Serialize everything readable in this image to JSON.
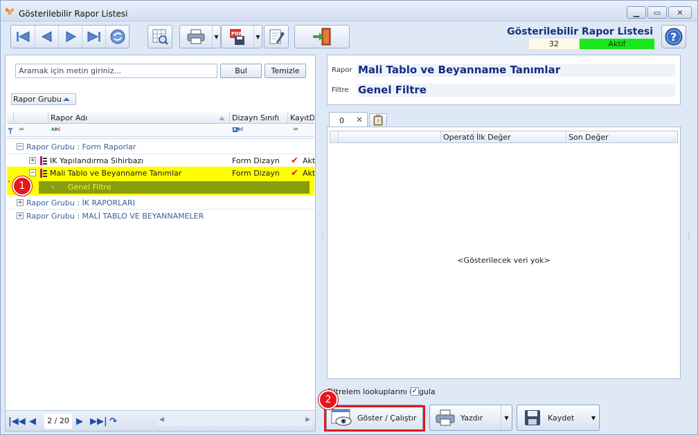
{
  "window": {
    "title": "Gösterilebilir Rapor Listesi"
  },
  "header": {
    "title": "Gösterilebilir Rapor Listesi",
    "count": "32",
    "status": "Aktif",
    "status_color": "#19e81c"
  },
  "toolbar": {
    "icons": [
      "first-icon",
      "prev-icon",
      "next-icon",
      "last-icon",
      "refresh-icon",
      "grid-search-icon",
      "print-icon",
      "pdf-export-icon",
      "settings-icon",
      "exit-icon"
    ]
  },
  "search": {
    "placeholder": "Aramak için metin giriniz...",
    "find_label": "Bul",
    "clear_label": "Temizle"
  },
  "group_panel": {
    "chip_label": "Rapor Grubu"
  },
  "grid": {
    "columns": [
      "Rapor Adı",
      "Dizayn Sınıfı",
      "KayıtDı"
    ],
    "groups": [
      {
        "label": "Rapor Grubu : Form Raporlar",
        "rows": [
          {
            "name": "IK Yapılandırma Sihirbazı",
            "design": "Form Dizayn",
            "status": "Akt"
          },
          {
            "name": "Mali Tablo ve Beyanname Tanımlar",
            "design": "Form Dizayn",
            "status": "Akt",
            "child": "Genel Filtre"
          }
        ]
      },
      {
        "label": "Rapor Grubu : İK RAPORLARI"
      },
      {
        "label": "Rapor Grubu : MALİ TABLO VE BEYANNAMELER"
      }
    ]
  },
  "pager": {
    "page": "2 / 20"
  },
  "detail": {
    "rapor_label": "Rapor",
    "rapor_value": "Mali Tablo ve Beyanname Tanımlar",
    "filtre_label": "Filtre",
    "filtre_value": "Genel Filtre"
  },
  "tabs": {
    "active": "0"
  },
  "filter_grid": {
    "columns": [
      "Operatör",
      "İlk Değer",
      "Son Değer"
    ],
    "empty_text": "<Gösterilecek veri yok>"
  },
  "options": {
    "apply_lookups_label": "Filtrelem lookuplarını uygula",
    "apply_lookups_checked": true
  },
  "actions": {
    "run_label": "Göster / Çalıştır",
    "print_label": "Yazdır",
    "save_label": "Kaydet"
  },
  "callouts": [
    "1",
    "2"
  ],
  "colors": {
    "highlight": "#ffff00",
    "selected_child": "#879d0b",
    "callout": "#e8151b",
    "title_text": "#14337a"
  }
}
